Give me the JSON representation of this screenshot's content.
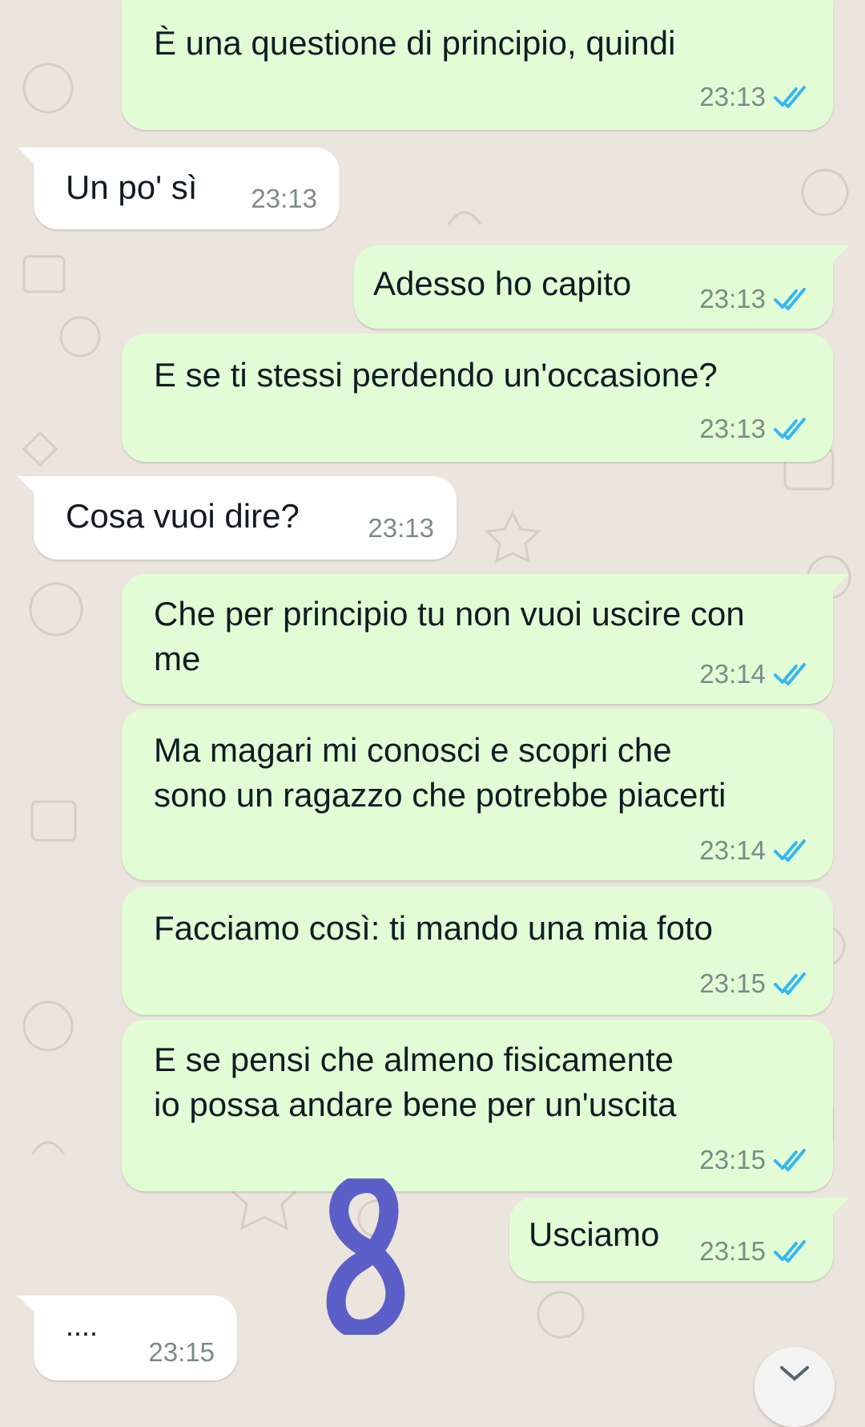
{
  "colors": {
    "outgoing_bubble": "#e2fdd6",
    "incoming_bubble": "#ffffff",
    "read_ticks": "#34b7f1",
    "annotation": "#5b5fc7"
  },
  "messages": [
    {
      "direction": "out",
      "text": "È una questione di principio, quindi",
      "time": "23:13",
      "status": "read"
    },
    {
      "direction": "in",
      "text": "Un po' sì",
      "time": "23:13"
    },
    {
      "direction": "out",
      "text": "Adesso ho capito",
      "time": "23:13",
      "status": "read"
    },
    {
      "direction": "out",
      "text": "E se ti stessi perdendo un'occasione?",
      "time": "23:13",
      "status": "read"
    },
    {
      "direction": "in",
      "text": "Cosa vuoi dire?",
      "time": "23:13"
    },
    {
      "direction": "out",
      "text": "Che per principio tu non vuoi uscire con\nme",
      "time": "23:14",
      "status": "read"
    },
    {
      "direction": "out",
      "text": "Ma magari mi conosci e scopri che\nsono un ragazzo che potrebbe piacerti",
      "time": "23:14",
      "status": "read"
    },
    {
      "direction": "out",
      "text": "Facciamo così: ti mando una mia foto",
      "time": "23:15",
      "status": "read"
    },
    {
      "direction": "out",
      "text": "E se pensi che almeno fisicamente\nio possa andare bene per un'uscita",
      "time": "23:15",
      "status": "read"
    },
    {
      "direction": "out",
      "text": "Usciamo",
      "time": "23:15",
      "status": "read"
    },
    {
      "direction": "in",
      "text": "....",
      "time": "23:15"
    }
  ],
  "annotation": {
    "text": "8"
  },
  "icons": {
    "scroll_down": "chevron-down-icon",
    "read_receipt": "double-check-icon"
  }
}
